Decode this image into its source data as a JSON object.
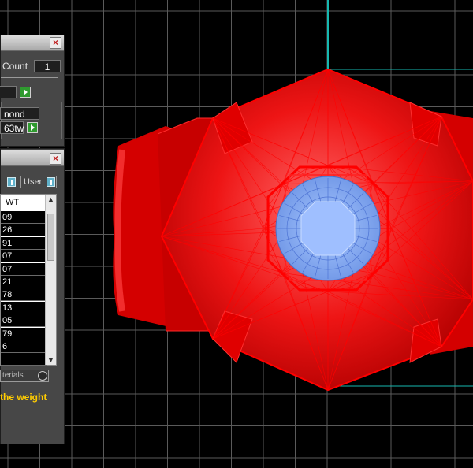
{
  "counter": {
    "label": "Count",
    "value": "1"
  },
  "gem": {
    "name": "nond",
    "weight": "63tw"
  },
  "tabs": {
    "user": "User"
  },
  "table": {
    "header": "WT",
    "rows": [
      "09",
      "26",
      "91",
      "07",
      "07",
      "21",
      "78",
      "13",
      "05",
      "79",
      "6",
      ""
    ]
  },
  "materials_label": "terials",
  "hint": "the weight",
  "colors": {
    "wireframe": "#ff0000",
    "grid": "#5a5a5a",
    "stone": "#8fb4f0",
    "hint_text": "#ffcc00",
    "axis": "#16b8b0"
  }
}
